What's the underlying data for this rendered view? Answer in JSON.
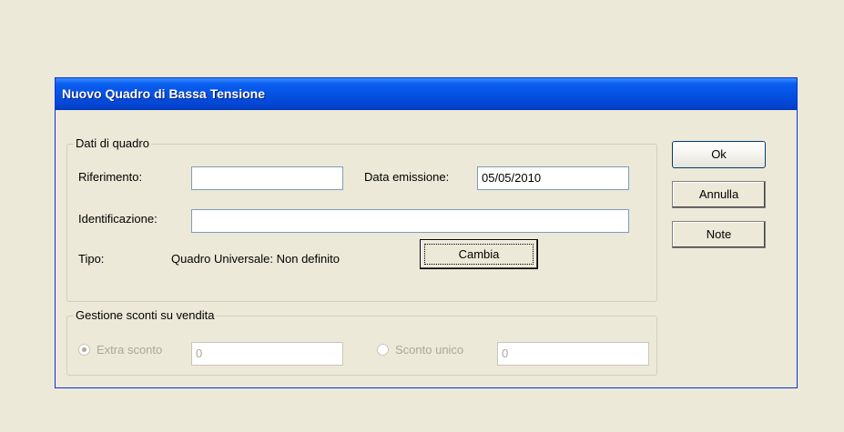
{
  "dialog": {
    "title": "Nuovo Quadro di Bassa Tensione",
    "group_quadro": {
      "legend": "Dati di quadro",
      "riferimento_label": "Riferimento:",
      "riferimento_value": "",
      "data_emissione_label": "Data emissione:",
      "data_emissione_value": "05/05/2010",
      "identificazione_label": "Identificazione:",
      "identificazione_value": "",
      "tipo_label": "Tipo:",
      "tipo_value": "Quadro Universale: Non definito",
      "cambia_label": "Cambia"
    },
    "group_sconti": {
      "legend": "Gestione sconti su vendita",
      "extra_sconto_label": "Extra sconto",
      "extra_sconto_value": "0",
      "extra_sconto_selected": true,
      "sconto_unico_label": "Sconto unico",
      "sconto_unico_value": "0",
      "sconto_unico_selected": false
    },
    "buttons": {
      "ok_label": "Ok",
      "annulla_label": "Annulla",
      "note_label": "Note"
    }
  }
}
